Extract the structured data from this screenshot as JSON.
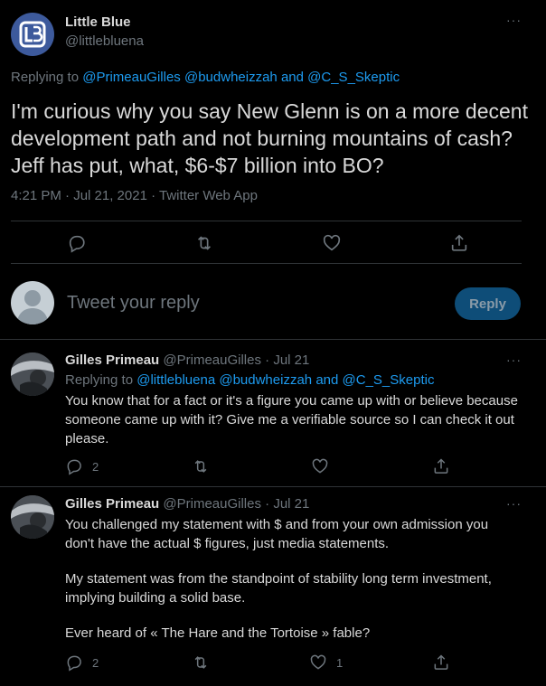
{
  "main_tweet": {
    "author_name": "Little Blue",
    "author_handle": "@littlebluena",
    "replying_to_prefix": "Replying to",
    "replying_to": [
      "@PrimeauGilles",
      "@budwheizzah",
      "and",
      "@C_S_Skeptic"
    ],
    "text": "I'm curious why you say New Glenn is on a more decent development path and not burning mountains of cash? Jeff has put, what, $6-$7 billion into BO?",
    "meta": "4:21 PM · Jul 21, 2021 · Twitter Web App"
  },
  "composer": {
    "placeholder": "Tweet your reply",
    "reply_button": "Reply"
  },
  "replies": [
    {
      "author_name": "Gilles Primeau",
      "author_handle": "@PrimeauGilles",
      "date": "· Jul 21",
      "replying_to_prefix": "Replying to",
      "replying_to": [
        "@littlebluena",
        "@budwheizzah",
        "and",
        "@C_S_Skeptic"
      ],
      "text": "You know that for a fact or it's a figure you came up with or believe because someone came up with it? Give me a verifiable source so I can check it out please.",
      "reply_count": "2",
      "like_count": ""
    },
    {
      "author_name": "Gilles Primeau",
      "author_handle": "@PrimeauGilles",
      "date": "· Jul 21",
      "paragraphs": [
        "You challenged my statement with $ and from your own admission you don't have the actual $ figures, just media statements.",
        "My statement was from the standpoint of stability long term investment, implying building a solid base.",
        "Ever heard of « The Hare and the Tortoise » fable?"
      ],
      "reply_count": "2",
      "like_count": "1"
    }
  ],
  "more_glyph": "···"
}
